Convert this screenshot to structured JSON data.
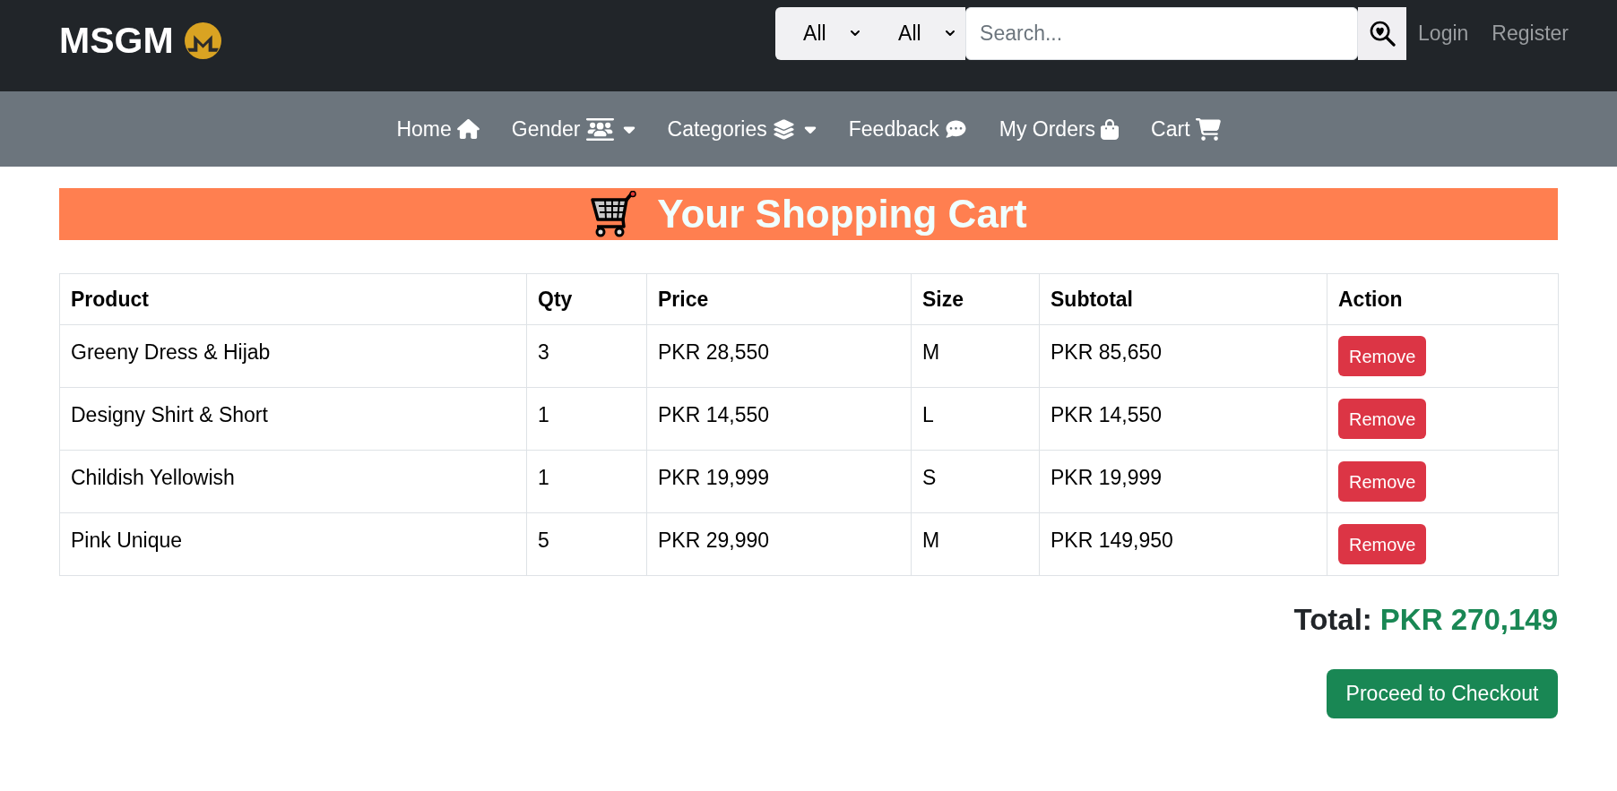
{
  "header": {
    "brand": "MSGM",
    "filters": [
      {
        "value": "All"
      },
      {
        "value": "All"
      }
    ],
    "search": {
      "placeholder": "Search..."
    },
    "links": [
      "Login",
      "Register"
    ]
  },
  "nav": {
    "items": [
      {
        "label": "Home",
        "dropdown": false
      },
      {
        "label": "Gender",
        "dropdown": true
      },
      {
        "label": "Categories",
        "dropdown": true
      },
      {
        "label": "Feedback",
        "dropdown": false
      },
      {
        "label": "My Orders",
        "dropdown": false
      },
      {
        "label": "Cart",
        "dropdown": false
      }
    ]
  },
  "cart": {
    "title": "Your Shopping Cart",
    "table": {
      "columns": [
        "Product",
        "Qty",
        "Price",
        "Size",
        "Subtotal",
        "Action"
      ],
      "rows": [
        {
          "cells": [
            "Greeny Dress & Hijab",
            "3",
            "PKR 28,550",
            "M",
            "PKR 85,650"
          ],
          "action": "Remove"
        },
        {
          "cells": [
            "Designy Shirt & Short",
            "1",
            "PKR 14,550",
            "L",
            "PKR 14,550"
          ],
          "action": "Remove"
        },
        {
          "cells": [
            "Childish Yellowish",
            "1",
            "PKR 19,999",
            "S",
            "PKR 19,999"
          ],
          "action": "Remove"
        },
        {
          "cells": [
            "Pink Unique",
            "5",
            "PKR 29,990",
            "M",
            "PKR 149,950"
          ],
          "action": "Remove"
        }
      ]
    },
    "total": {
      "label": "Total:",
      "value": "PKR 270,149"
    },
    "checkout": "Proceed to Checkout"
  }
}
